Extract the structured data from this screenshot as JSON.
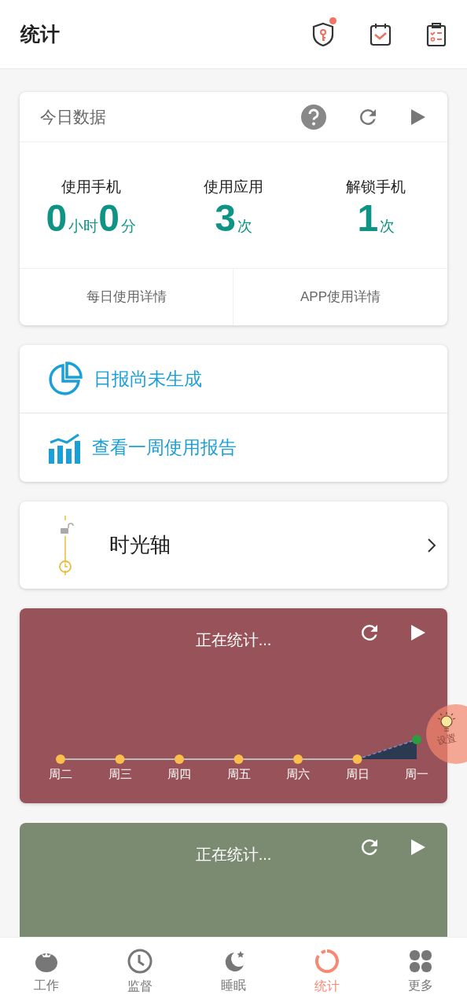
{
  "header": {
    "title": "统计",
    "notification_dot": true
  },
  "today": {
    "title": "今日数据",
    "stats": [
      {
        "label": "使用手机",
        "parts": [
          {
            "kind": "number",
            "text": "0"
          },
          {
            "kind": "unit",
            "text": "小时"
          },
          {
            "kind": "number",
            "text": "0"
          },
          {
            "kind": "unit",
            "text": "分"
          }
        ]
      },
      {
        "label": "使用应用",
        "parts": [
          {
            "kind": "number",
            "text": "3"
          },
          {
            "kind": "unit",
            "text": "次"
          }
        ]
      },
      {
        "label": "解锁手机",
        "parts": [
          {
            "kind": "number",
            "text": "1"
          },
          {
            "kind": "unit",
            "text": "次"
          }
        ]
      }
    ],
    "links": [
      "每日使用详情",
      "APP使用详情"
    ]
  },
  "reports": [
    {
      "kind": "pie",
      "label": "日报尚未生成"
    },
    {
      "kind": "bars",
      "label": "查看一周使用报告"
    }
  ],
  "timeline": {
    "label": "时光轴"
  },
  "weekly_cards": [
    {
      "color": "#985259",
      "status": "正在统计...",
      "days": [
        "周二",
        "周三",
        "周四",
        "周五",
        "周六",
        "周日",
        "周一"
      ]
    },
    {
      "color": "#7b8b72",
      "status": "正在统计..."
    }
  ],
  "floating_bubble": {
    "label": "设置"
  },
  "nav": [
    {
      "kind": "tomato",
      "label": "工作",
      "selected": false
    },
    {
      "kind": "clock",
      "label": "监督",
      "selected": false
    },
    {
      "kind": "moon",
      "label": "睡眠",
      "selected": false
    },
    {
      "kind": "ring",
      "label": "统计",
      "selected": true
    },
    {
      "kind": "clover",
      "label": "更多",
      "selected": false
    }
  ]
}
